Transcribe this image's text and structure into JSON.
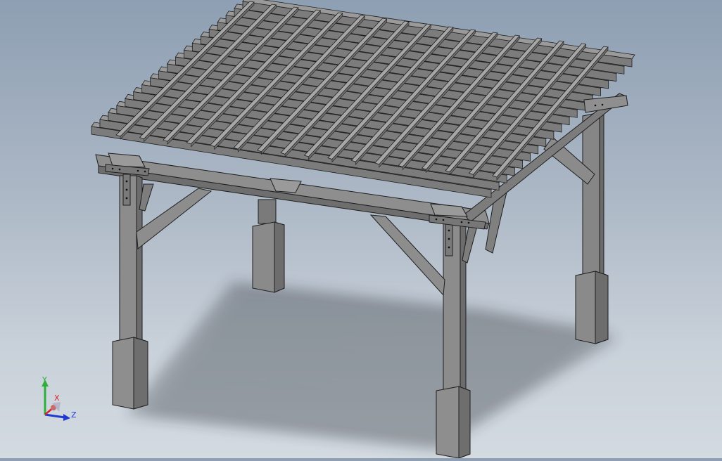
{
  "app": {
    "colors": {
      "background_top": "#8e9fb3",
      "background_bottom": "#d3dae1",
      "wood_face": "#8a8a8a",
      "wood_side": "#6e6e6e",
      "wood_top": "#9b9b9b",
      "edge": "#1e1e1e",
      "shadow": "#2b2d33"
    }
  },
  "viewport": {
    "model": {
      "posts": 4,
      "braces": 4,
      "roof_rafters": 19,
      "top_slats": 17
    }
  },
  "triad": {
    "x_label": "X",
    "y_label": "Y",
    "z_label": "Z",
    "x_color": "#d8232a",
    "y_color": "#2fae3a",
    "z_color": "#1f3ad1"
  }
}
